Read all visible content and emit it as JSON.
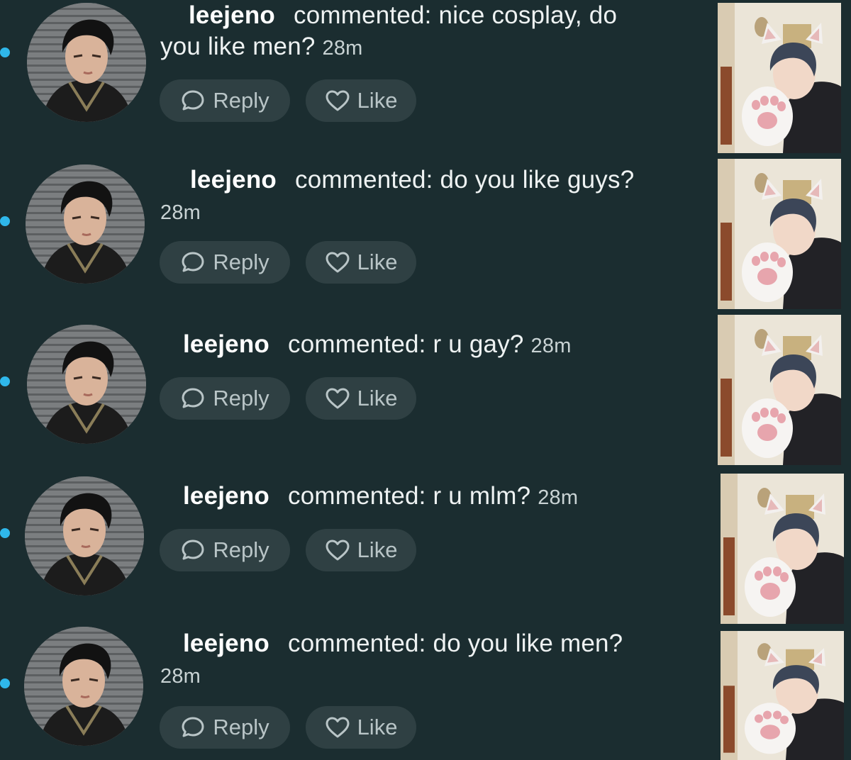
{
  "notifications": [
    {
      "username": "leejeno",
      "comment": "commented: nice cosplay, do you like men?",
      "comment_line1": "commented: nice cosplay, do",
      "comment_line2": "you like men?",
      "time": "28m",
      "reply_label": "Reply",
      "like_label": "Like",
      "unread": true
    },
    {
      "username": "leejeno",
      "comment": "commented: do you like guys?",
      "time": "28m",
      "reply_label": "Reply",
      "like_label": "Like",
      "unread": true
    },
    {
      "username": "leejeno",
      "comment": "commented: r u gay?",
      "time": "28m",
      "reply_label": "Reply",
      "like_label": "Like",
      "unread": true
    },
    {
      "username": "leejeno",
      "comment": "commented: r u mlm?",
      "time": "28m",
      "reply_label": "Reply",
      "like_label": "Like",
      "unread": true
    },
    {
      "username": "leejeno",
      "comment": "commented: do you like men?",
      "time": "28m",
      "reply_label": "Reply",
      "like_label": "Like",
      "unread": true
    }
  ],
  "icons": {
    "reply": "speech-bubble-icon",
    "like": "heart-outline-icon"
  },
  "colors": {
    "background": "#1b2d30",
    "unread_dot": "#2fb7ea",
    "button_bg": "#2f4043",
    "button_text": "#b9c5c7"
  }
}
